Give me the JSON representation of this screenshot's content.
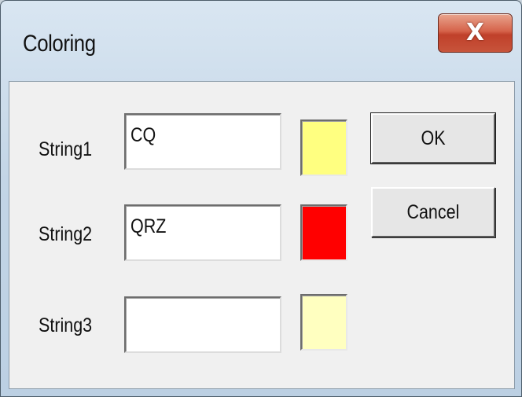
{
  "window": {
    "title": "Coloring",
    "close_label": "X"
  },
  "rows": [
    {
      "label": "String1",
      "value": "CQ",
      "color": "#ffff80"
    },
    {
      "label": "String2",
      "value": "QRZ",
      "color": "#ff0000"
    },
    {
      "label": "String3",
      "value": "",
      "color": "#ffffc0"
    }
  ],
  "buttons": {
    "ok_label": "OK",
    "cancel_label": "Cancel"
  }
}
